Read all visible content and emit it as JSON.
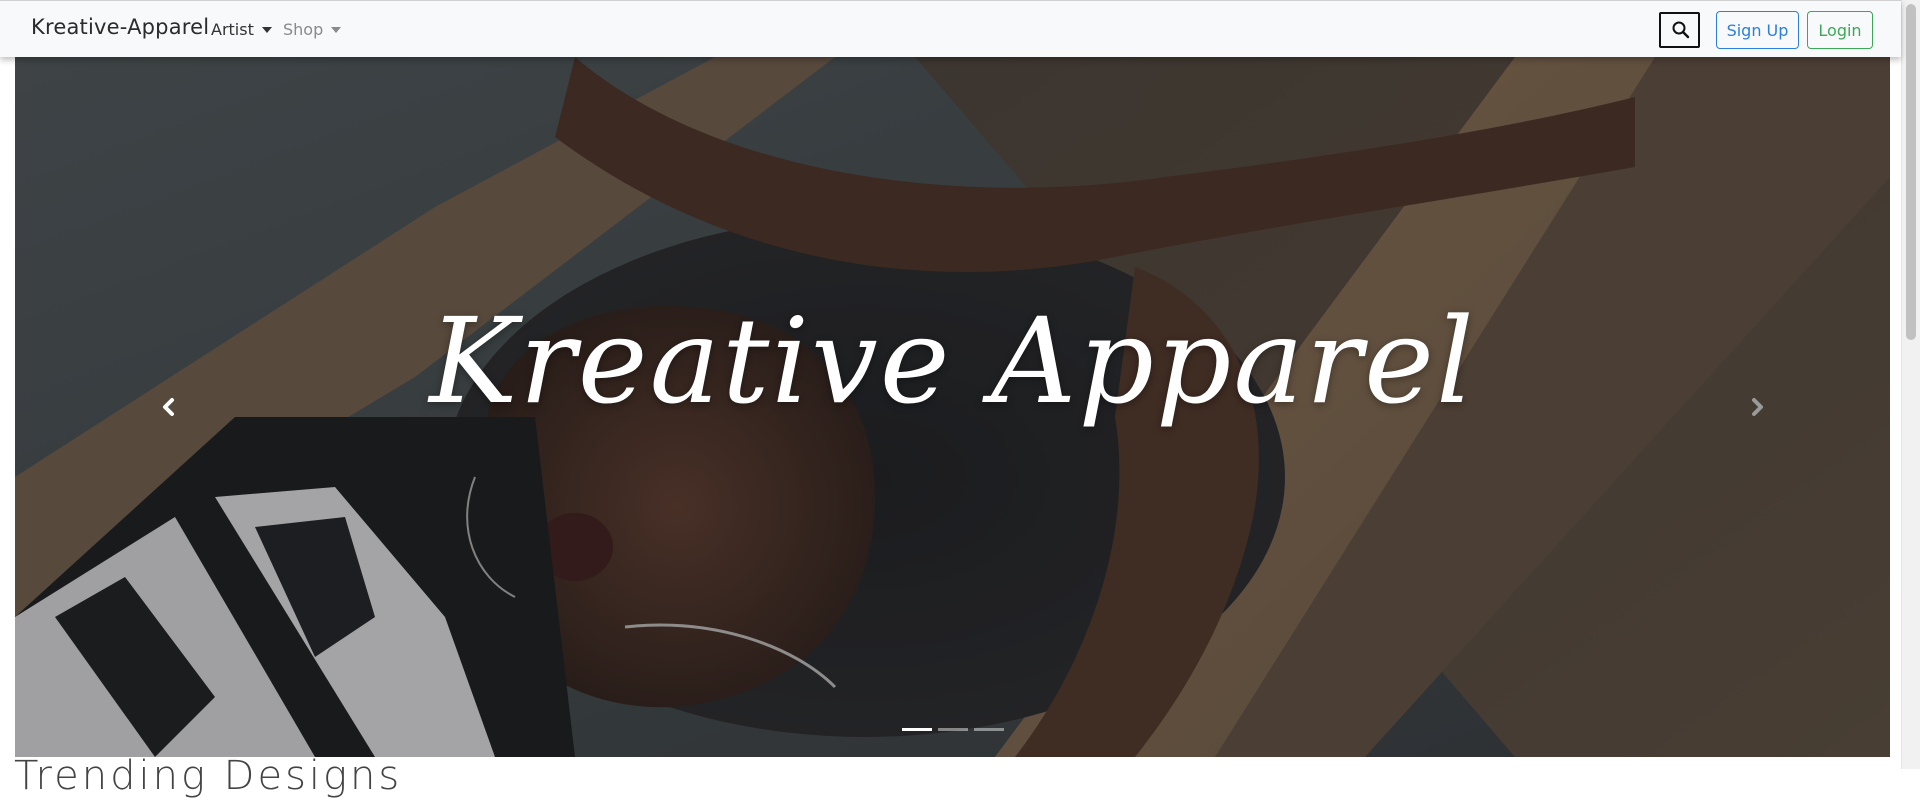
{
  "nav": {
    "brand": "Kreative-Apparel",
    "artist_label": "Artist",
    "shop_label": "Shop",
    "signup_label": "Sign Up",
    "login_label": "Login",
    "search_icon": "search-icon"
  },
  "hero": {
    "title": "Kreative Apparel",
    "prev_icon": "chevron-left-icon",
    "next_icon": "chevron-right-icon",
    "slide_count": 3,
    "active_slide": 1
  },
  "section": {
    "heading": "Trending Designs"
  },
  "colors": {
    "signup": "#2b7fe0",
    "login": "#3aa856",
    "navbar_bg": "#f8f9fa"
  }
}
